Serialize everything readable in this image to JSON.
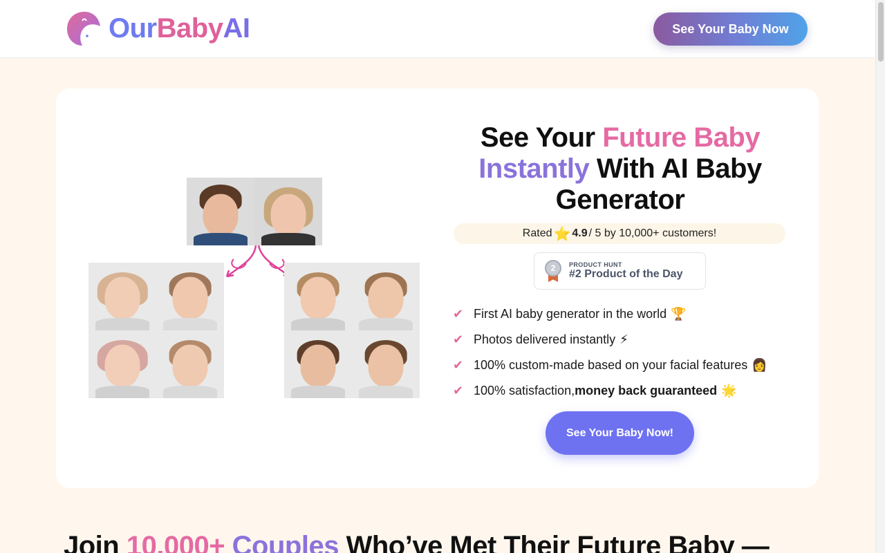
{
  "header": {
    "logo": {
      "part1": "Our",
      "part2": "Baby",
      "part3": "AI"
    },
    "cta_label": "See Your Baby Now"
  },
  "hero": {
    "title": {
      "part1": "See Your ",
      "highlight1": "Future Baby",
      "highlight2": "Instantly",
      "part2": " With AI Baby Generator"
    },
    "rating": {
      "prefix": "Rated ",
      "star": "⭐",
      "score": "4.9",
      "suffix": " / 5 by 10,000+ customers!"
    },
    "product_hunt": {
      "label_small": "PRODUCT HUNT",
      "label_big": "#2 Product of the Day",
      "rank": "2"
    },
    "features": [
      {
        "text": "First AI baby generator in the world",
        "bold": "",
        "emoji": "🏆"
      },
      {
        "text": "Photos delivered instantly",
        "bold": "",
        "emoji": "⚡"
      },
      {
        "text": "100% custom-made based on your facial features",
        "bold": "",
        "emoji": "👩"
      },
      {
        "text": "100% satisfaction, ",
        "bold": "money back guaranteed",
        "emoji": "🌟"
      }
    ],
    "cta_label": "See Your Baby Now!"
  },
  "section": {
    "title_part1": "Join ",
    "title_number": "10,000+",
    "title_space": " ",
    "title_couples": "Couples",
    "title_part2": " Who’ve Met Their Future Baby —"
  },
  "colors": {
    "pink": "#e56aa3",
    "purple": "#8a73db",
    "cta": "#6e72f1",
    "page_bg": "#fff7ee"
  },
  "icons": {
    "check": "check-icon",
    "star": "star-icon",
    "medal": "medal-icon"
  }
}
